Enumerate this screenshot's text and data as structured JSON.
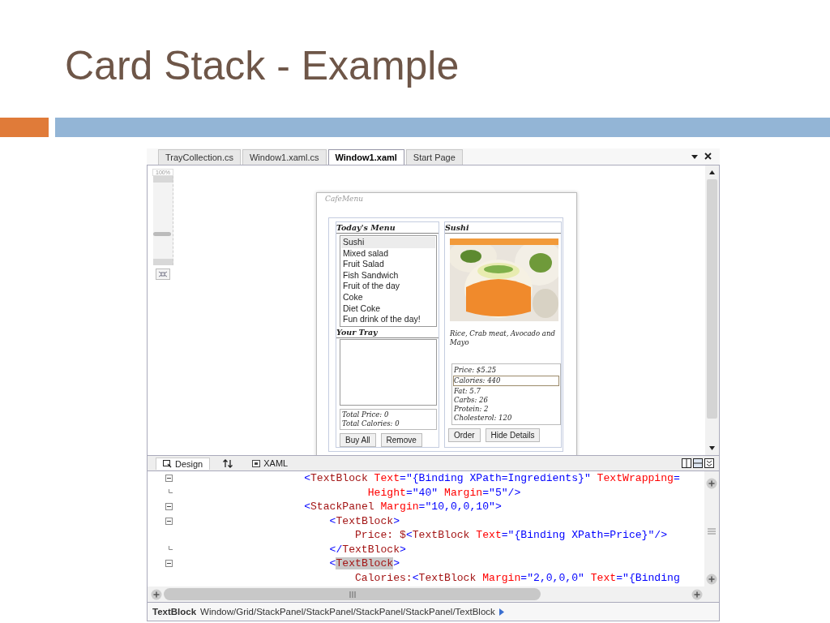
{
  "slide": {
    "title": "Card Stack - Example"
  },
  "ide": {
    "tabs": [
      {
        "label": "TrayCollection.cs",
        "selected": false
      },
      {
        "label": "Window1.xaml.cs",
        "selected": false
      },
      {
        "label": "Window1.xaml",
        "selected": true
      },
      {
        "label": "Start Page",
        "selected": false
      }
    ],
    "zoom": {
      "label": "100%",
      "level": 0.35
    },
    "preview": {
      "window_title": "CafeMenu",
      "menu_heading": "Today's Menu",
      "menu_items": [
        {
          "label": "Sushi",
          "selected": true
        },
        {
          "label": "Mixed salad",
          "selected": false
        },
        {
          "label": "Fruit Salad",
          "selected": false
        },
        {
          "label": "Fish Sandwich",
          "selected": false
        },
        {
          "label": "Fruit of the day",
          "selected": false
        },
        {
          "label": "Coke",
          "selected": false
        },
        {
          "label": "Diet Coke",
          "selected": false
        },
        {
          "label": "Fun drink of the day!",
          "selected": false
        }
      ],
      "tray_heading": "Your Tray",
      "totals": [
        "Total Price: 0",
        "Total Calories: 0"
      ],
      "left_buttons": [
        "Buy All",
        "Remove"
      ],
      "detail_heading": "Sushi",
      "photo": {
        "kind": "picture"
      },
      "ingredients": "Rice, Crab meat, Avocado and Mayo",
      "nutrition": [
        {
          "text": "Price: $5.25",
          "selected": false
        },
        {
          "text": "Calories: 440",
          "selected": true
        },
        {
          "text": "Fat: 5.7",
          "selected": false
        },
        {
          "text": "Carbs: 26",
          "selected": false
        },
        {
          "text": "Protein: 2",
          "selected": false
        },
        {
          "text": "Cholesterol: 120",
          "selected": false
        }
      ],
      "right_buttons": [
        "Order",
        "Hide Details"
      ]
    },
    "view_tabs": [
      {
        "label": "Design",
        "kind": "design",
        "selected": true
      },
      {
        "kind": "swap",
        "selected": false
      },
      {
        "label": "XAML",
        "kind": "xaml",
        "selected": false
      }
    ],
    "code_lines": [
      {
        "fold_start": true,
        "fold_end": false,
        "segments": [
          {
            "kind": "punct",
            "text": "                    <"
          },
          {
            "kind": "tag",
            "text": "TextBlock"
          },
          {
            "kind": "attr",
            "text": " Text"
          },
          {
            "kind": "punct",
            "text": "=\""
          },
          {
            "kind": "value",
            "text": "{Binding XPath=Ingredients}"
          },
          {
            "kind": "punct",
            "text": "\""
          },
          {
            "kind": "attr",
            "text": " TextWrapping"
          },
          {
            "kind": "punct",
            "text": "="
          }
        ]
      },
      {
        "fold_start": false,
        "fold_end": true,
        "segments": [
          {
            "kind": "attr",
            "text": "                              Height"
          },
          {
            "kind": "punct",
            "text": "=\"40\""
          },
          {
            "kind": "attr",
            "text": " Margin"
          },
          {
            "kind": "punct",
            "text": "=\"5\"/>"
          }
        ]
      },
      {
        "fold_start": true,
        "fold_end": false,
        "segments": [
          {
            "kind": "punct",
            "text": "                    <"
          },
          {
            "kind": "tag",
            "text": "StackPanel"
          },
          {
            "kind": "attr",
            "text": " Margin"
          },
          {
            "kind": "punct",
            "text": "=\"10,0,0,10\">"
          }
        ]
      },
      {
        "fold_start": true,
        "fold_end": false,
        "segments": [
          {
            "kind": "punct",
            "text": "                        <"
          },
          {
            "kind": "tag",
            "text": "TextBlock"
          },
          {
            "kind": "punct",
            "text": ">"
          }
        ]
      },
      {
        "fold_start": false,
        "fold_end": false,
        "segments": [
          {
            "kind": "text",
            "text": "                            Price: $"
          },
          {
            "kind": "punct",
            "text": "<"
          },
          {
            "kind": "tag",
            "text": "TextBlock"
          },
          {
            "kind": "attr",
            "text": " Text"
          },
          {
            "kind": "punct",
            "text": "=\""
          },
          {
            "kind": "value",
            "text": "{Binding XPath=Price}"
          },
          {
            "kind": "punct",
            "text": "\"/>"
          }
        ]
      },
      {
        "fold_start": false,
        "fold_end": true,
        "segments": [
          {
            "kind": "punct",
            "text": "                        </"
          },
          {
            "kind": "tag",
            "text": "TextBlock"
          },
          {
            "kind": "punct",
            "text": ">"
          }
        ]
      },
      {
        "fold_start": true,
        "fold_end": false,
        "segments": [
          {
            "kind": "punct",
            "text": "                        <"
          },
          {
            "kind": "tag",
            "text": "TextBlock",
            "highlighted": true
          },
          {
            "kind": "punct",
            "text": ">"
          }
        ]
      },
      {
        "fold_start": false,
        "fold_end": false,
        "segments": [
          {
            "kind": "text",
            "text": "                            Calories:"
          },
          {
            "kind": "punct",
            "text": "<"
          },
          {
            "kind": "tag",
            "text": "TextBlock"
          },
          {
            "kind": "attr",
            "text": " Margin"
          },
          {
            "kind": "punct",
            "text": "=\"2,0,0,0\""
          },
          {
            "kind": "attr",
            "text": " Text"
          },
          {
            "kind": "punct",
            "text": "=\""
          },
          {
            "kind": "value",
            "text": "{Binding"
          }
        ]
      }
    ],
    "status": {
      "element": "TextBlock",
      "path": "Window/Grid/StackPanel/StackPanel/StackPanel/StackPanel/TextBlock"
    }
  }
}
